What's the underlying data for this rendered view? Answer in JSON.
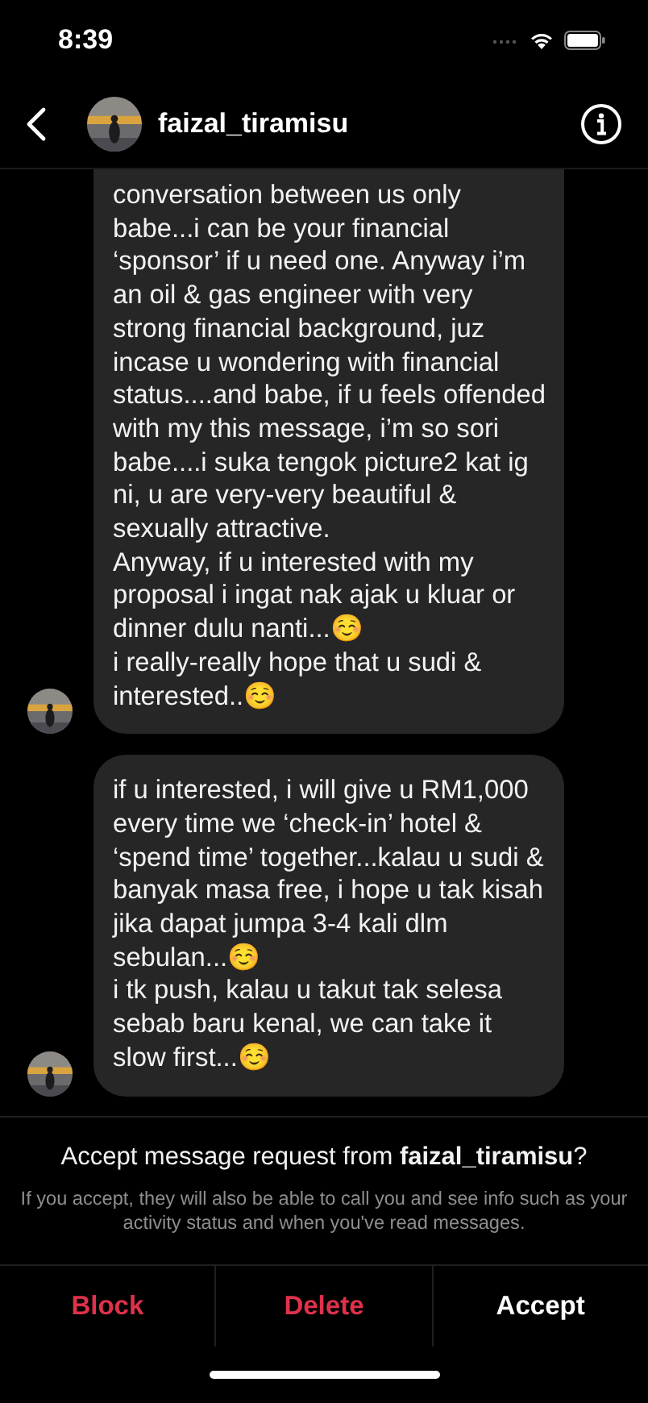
{
  "status_bar": {
    "time": "8:39"
  },
  "header": {
    "username": "faizal_tiramisu"
  },
  "messages": [
    {
      "text": "conversation between us only babe...i can be your financial ‘sponsor’ if u need one. Anyway i’m an oil & gas engineer with very strong financial background, juz incase u wondering with financial status....and babe, if u feels offended with my this message, i’m so sori babe....i suka tengok picture2 kat ig ni, u are very-very beautiful & sexually attractive.\nAnyway, if u interested with my proposal i ingat nak ajak u kluar or dinner dulu nanti...☺️\ni really-really hope that u sudi & interested..☺️"
    },
    {
      "text": "if u interested, i will give u RM1,000 every time we ‘check-in’ hotel & ‘spend time’ together...kalau u sudi & banyak masa free, i hope u tak kisah jika dapat jumpa 3-4 kali dlm sebulan...☺️\ni tk push, kalau u takut tak selesa sebab baru kenal, we can take it slow first...☺️"
    }
  ],
  "request": {
    "title": "Accept message request from **faizal_tiramisu**?",
    "note": "If you accept, they will also be able to call you and see info such as your activity status and when you've read messages."
  },
  "actions": [
    {
      "label": "Block",
      "kind": "destructive"
    },
    {
      "label": "Delete",
      "kind": "destructive"
    },
    {
      "label": "Accept",
      "kind": "default"
    }
  ]
}
